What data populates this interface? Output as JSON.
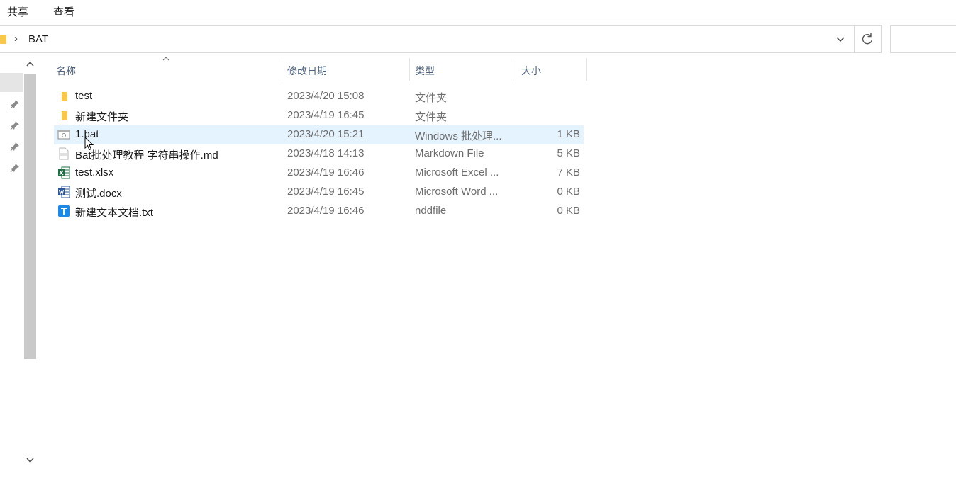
{
  "ribbon": {
    "share": "共享",
    "view": "查看"
  },
  "address": {
    "path": "BAT"
  },
  "columns": {
    "name": "名称",
    "date": "修改日期",
    "type": "类型",
    "size": "大小"
  },
  "files": [
    {
      "name": "test",
      "date": "2023/4/20 15:08",
      "type": "文件夹",
      "size": "",
      "icon": "folder-icon"
    },
    {
      "name": "新建文件夹",
      "date": "2023/4/19 16:45",
      "type": "文件夹",
      "size": "",
      "icon": "folder-icon"
    },
    {
      "name": "1.bat",
      "date": "2023/4/20 15:21",
      "type": "Windows 批处理...",
      "size": "1 KB",
      "icon": "batch-file-icon"
    },
    {
      "name": "Bat批处理教程 字符串操作.md",
      "date": "2023/4/18 14:13",
      "type": "Markdown File",
      "size": "5 KB",
      "icon": "markdown-file-icon"
    },
    {
      "name": "test.xlsx",
      "date": "2023/4/19 16:46",
      "type": "Microsoft Excel ...",
      "size": "7 KB",
      "icon": "excel-file-icon"
    },
    {
      "name": "测试.docx",
      "date": "2023/4/19 16:45",
      "type": "Microsoft Word ...",
      "size": "0 KB",
      "icon": "word-file-icon"
    },
    {
      "name": "新建文本文档.txt",
      "date": "2023/4/19 16:46",
      "type": "nddfile",
      "size": "0 KB",
      "icon": "text-file-icon"
    }
  ],
  "colors": {
    "selected_row": "#e5f3ff",
    "header_text": "#4c607a",
    "folder": "#f8c74c",
    "excel": "#1d6f42",
    "word": "#2b579a",
    "text_file": "#1e88e5"
  }
}
